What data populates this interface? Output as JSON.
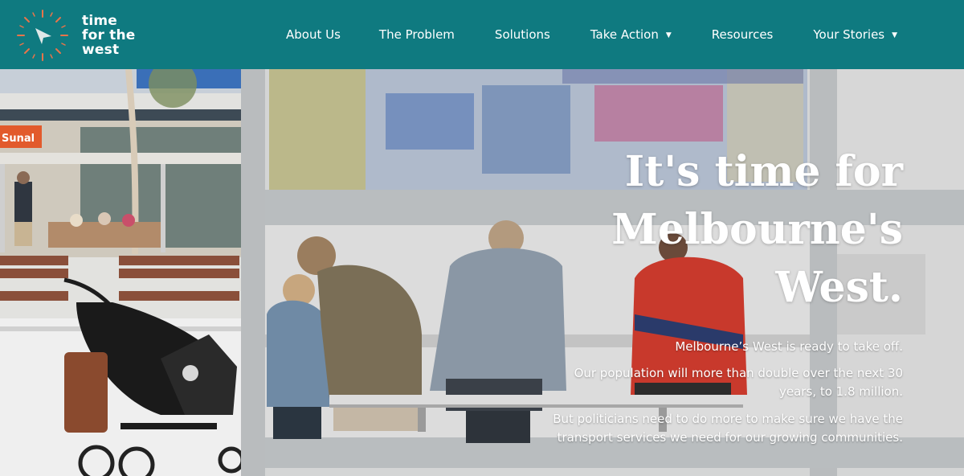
{
  "brand": {
    "name_lines": [
      "time",
      "for the",
      "west"
    ],
    "primary_color": "#0f7a80",
    "logo_icon": "compass-clock-icon"
  },
  "nav": {
    "items": [
      {
        "label": "About Us",
        "dropdown": false
      },
      {
        "label": "The Problem",
        "dropdown": false
      },
      {
        "label": "Solutions",
        "dropdown": false
      },
      {
        "label": "Take Action",
        "dropdown": true,
        "caret": "▼"
      },
      {
        "label": "Resources",
        "dropdown": false
      },
      {
        "label": "Your Stories",
        "dropdown": true,
        "caret": "▼"
      }
    ]
  },
  "hero": {
    "headline_lines": [
      "It's time for",
      "Melbourne's",
      "West."
    ],
    "paragraphs": [
      "Melbourne’s West is ready to take off.",
      "Our population will more than double over the next 30 years, to 1.8 million.",
      "But politicians need to do more to make sure we have the transport services we need for our growing communities."
    ],
    "background_scene": "people-waiting-at-bus-shelter-photo",
    "store_sign_text": "Sunal"
  }
}
